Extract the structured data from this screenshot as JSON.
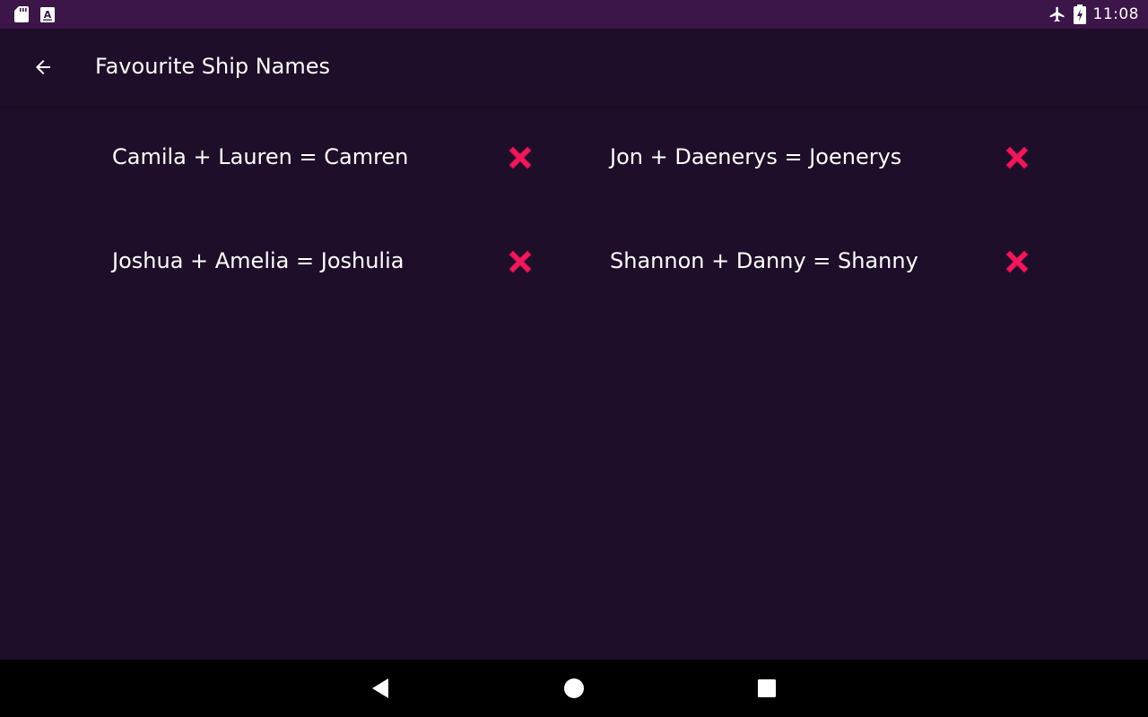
{
  "status_bar": {
    "time": "11:08",
    "left_icons": [
      "sd-card-icon",
      "keyboard-a-icon"
    ],
    "right_icons": [
      "airplane-mode-icon",
      "battery-charging-icon"
    ]
  },
  "app_bar": {
    "back_icon": "arrow-back-icon",
    "title": "Favourite Ship Names"
  },
  "ships": [
    {
      "text": "Camila + Lauren = Camren",
      "delete_icon": "close-icon"
    },
    {
      "text": "Jon + Daenerys = Joenerys",
      "delete_icon": "close-icon"
    },
    {
      "text": "Joshua + Amelia = Joshulia",
      "delete_icon": "close-icon"
    },
    {
      "text": "Shannon + Danny = Shanny",
      "delete_icon": "close-icon"
    }
  ],
  "nav_bar": {
    "back": "nav-back-icon",
    "home": "nav-home-icon",
    "recents": "nav-recents-icon"
  },
  "colors": {
    "status_bar": "#3c1549",
    "background": "#1e0e29",
    "delete_accent": "#f0185c",
    "nav_bar": "#000000"
  }
}
